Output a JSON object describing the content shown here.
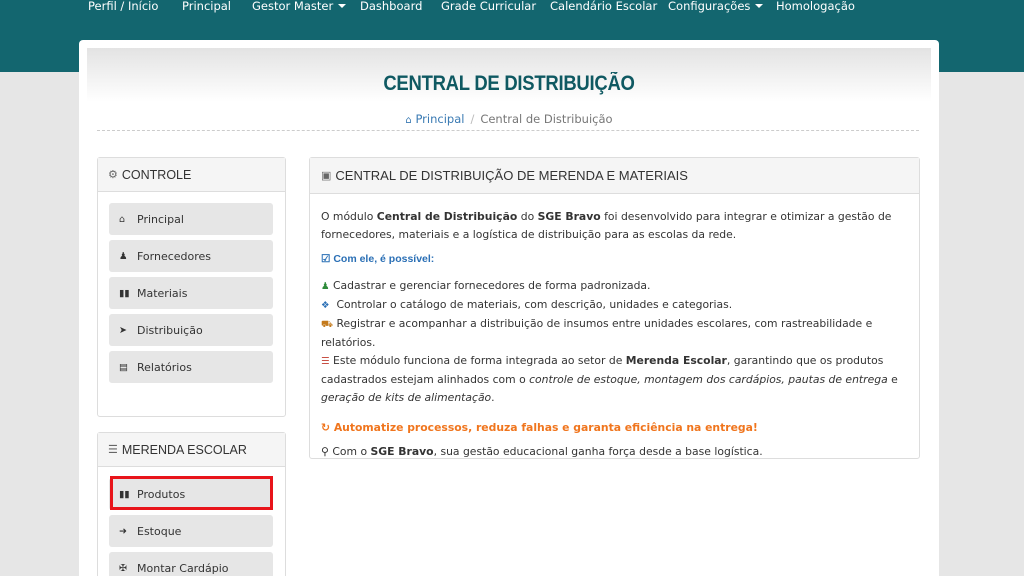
{
  "nav": {
    "items": [
      {
        "label": "Perfil / Início"
      },
      {
        "label": "Principal"
      },
      {
        "label": "Gestor Master"
      },
      {
        "label": "Dashboard"
      },
      {
        "label": "Grade Curricular"
      },
      {
        "label": "Calendário Escolar"
      },
      {
        "label": "Configurações"
      },
      {
        "label": "Homologação"
      }
    ]
  },
  "page": {
    "title": "CENTRAL DE DISTRIBUIÇÃO",
    "breadcrumb": {
      "home": "Principal",
      "current": "Central de Distribuição"
    }
  },
  "controle": {
    "title": "CONTROLE",
    "items": [
      {
        "label": "Principal",
        "icon": "home-icon"
      },
      {
        "label": "Fornecedores",
        "icon": "user-icon"
      },
      {
        "label": "Materiais",
        "icon": "barcode-icon"
      },
      {
        "label": "Distribuição",
        "icon": "arrow-circle-icon"
      },
      {
        "label": "Relatórios",
        "icon": "document-icon"
      }
    ]
  },
  "merenda": {
    "title": "MERENDA ESCOLAR",
    "items": [
      {
        "label": "Produtos",
        "icon": "barcode-icon"
      },
      {
        "label": "Estoque",
        "icon": "sign-in-icon"
      },
      {
        "label": "Montar Cardápio",
        "icon": "puzzle-icon"
      }
    ]
  },
  "content": {
    "title": "CENTRAL DE DISTRIBUIÇÃO DE MERENDA E MATERIAIS",
    "intro": {
      "a": "O módulo ",
      "b": "Central de Distribuição",
      "c": " do ",
      "d": "SGE Bravo",
      "e": " foi desenvolvido para integrar e otimizar a gestão de fornecedores, materiais e a logística de distribuição para as escolas da rede."
    },
    "subtitle": "Com ele, é possível:",
    "features": {
      "f1": "Cadastrar e gerenciar fornecedores de forma padronizada.",
      "f2": "Controlar o catálogo de materiais, com descrição, unidades e categorias.",
      "f3": "Registrar e acompanhar a distribuição de insumos entre unidades escolares, com rastreabilidade e relatórios.",
      "f4a": "Este módulo funciona de forma integrada ao setor de ",
      "f4b": "Merenda Escolar",
      "f4c": ", garantindo que os produtos cadastrados estejam alinhados com o ",
      "f4d": "controle de estoque, montagem dos cardápios, pautas de entrega",
      "f4e": " e ",
      "f4f": "geração de kits de alimentação",
      "f4g": "."
    },
    "callout": "Automatize processos, reduza falhas e garanta eficiência na entrega!",
    "closing": {
      "a": "Com o ",
      "b": "SGE Bravo",
      "c": ", sua gestão educacional ganha força desde a base logística."
    }
  },
  "colors": {
    "topbar": "#13666f",
    "title": "#0f5962",
    "link": "#3a7ab3",
    "callout": "#f0751d",
    "highlight": "#e8141a"
  }
}
